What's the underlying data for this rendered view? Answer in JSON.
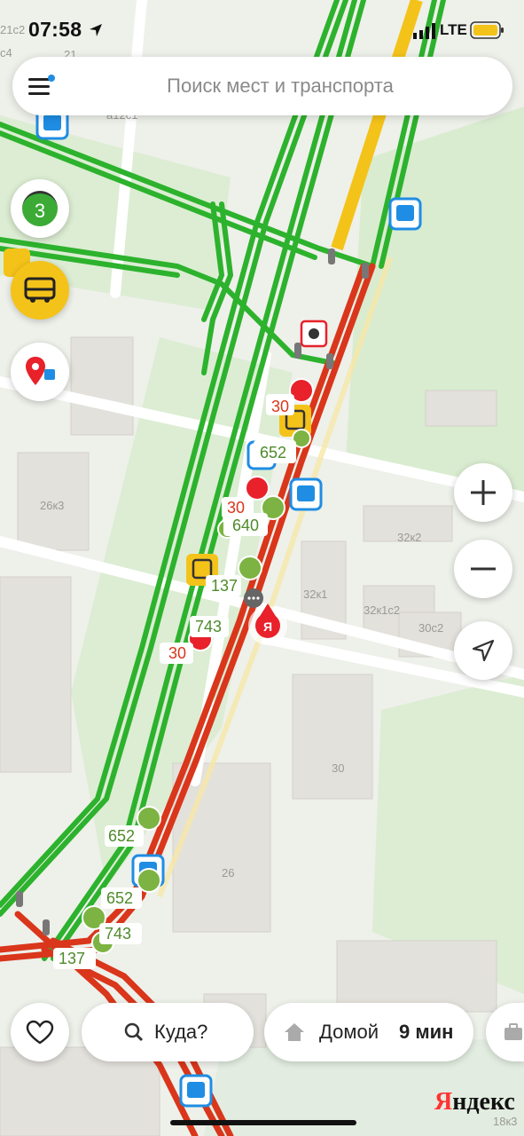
{
  "status_bar": {
    "time": "07:58",
    "network": "LTE"
  },
  "search": {
    "placeholder": "Поиск мест и транспорта"
  },
  "layers": {
    "traffic_score": "3"
  },
  "map": {
    "buildings": [
      "21c2",
      "21",
      "c4",
      "a12c1",
      "26к3",
      "32к2",
      "32к1",
      "32к1с2",
      "30с2",
      "30",
      "26",
      "18к3"
    ],
    "transport_labels": [
      "30",
      "652",
      "30",
      "640",
      "137",
      "743",
      "30",
      "652",
      "652",
      "743",
      "137"
    ],
    "logo": "Яндекс"
  },
  "bottom_bar": {
    "where": "Куда?",
    "home": "Домой",
    "home_time": "9 мин"
  },
  "colors": {
    "green_road": "#2db22d",
    "red_road": "#d9361b",
    "yellow_road": "#f4c31a",
    "accent_red": "#e8212a",
    "bus_blue": "#1f8de3"
  }
}
